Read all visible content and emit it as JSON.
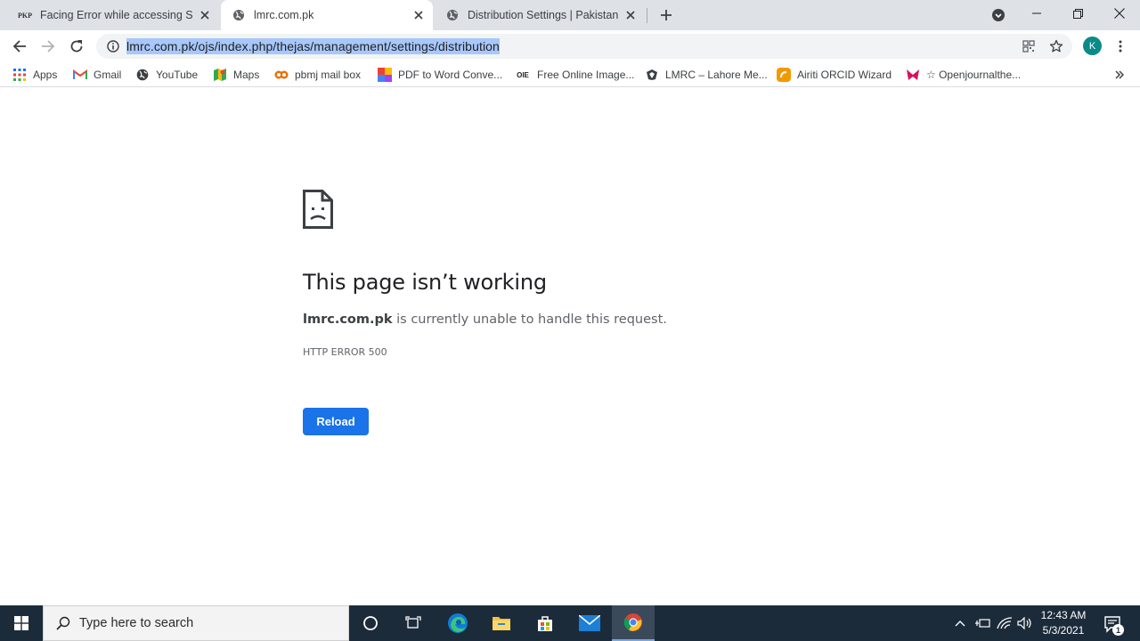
{
  "tabs": [
    {
      "title": "Facing Error while accessing Setti",
      "favicon": "pkp-icon",
      "active": false
    },
    {
      "title": "lmrc.com.pk",
      "favicon": "globe-icon",
      "active": true
    },
    {
      "title": "Distribution Settings | Pakistan Bi",
      "favicon": "globe-icon",
      "active": false
    }
  ],
  "favicon_text": {
    "pkp": "PKP"
  },
  "toolbar": {
    "url": "lmrc.com.pk/ojs/index.php/thejas/management/settings/distribution",
    "avatar_letter": "K"
  },
  "bookmarks": [
    {
      "label": "Apps",
      "icon": "apps-grid-icon"
    },
    {
      "label": "Gmail",
      "icon": "gmail-icon"
    },
    {
      "label": "YouTube",
      "icon": "globe-icon"
    },
    {
      "label": "Maps",
      "icon": "maps-icon"
    },
    {
      "label": "pbmj mail box",
      "icon": "pbmj-icon"
    },
    {
      "label": "PDF to Word Conve...",
      "icon": "pdf-icon"
    },
    {
      "label": "Free Online Image...",
      "icon": "oie-icon"
    },
    {
      "label": "LMRC – Lahore Me...",
      "icon": "lmrc-icon"
    },
    {
      "label": "Airiti ORCID Wizard",
      "icon": "airiti-icon"
    },
    {
      "label": "☆ Openjournalthe...",
      "icon": "ojt-icon"
    }
  ],
  "bookmark_icon_text": {
    "oie": "OIE"
  },
  "error_page": {
    "title": "This page isn’t working",
    "host": "lmrc.com.pk",
    "message_rest": " is currently unable to handle this request.",
    "code": "HTTP ERROR 500",
    "reload_label": "Reload"
  },
  "taskbar": {
    "search_placeholder": "Type here to search",
    "time": "12:43 AM",
    "date": "5/3/2021",
    "notification_count": "1"
  },
  "colors": {
    "accent": "#1a73e8",
    "tabstrip": "#dee1e6",
    "taskbar": "#1c2b3a",
    "url_selection": "#a8c7fa"
  }
}
